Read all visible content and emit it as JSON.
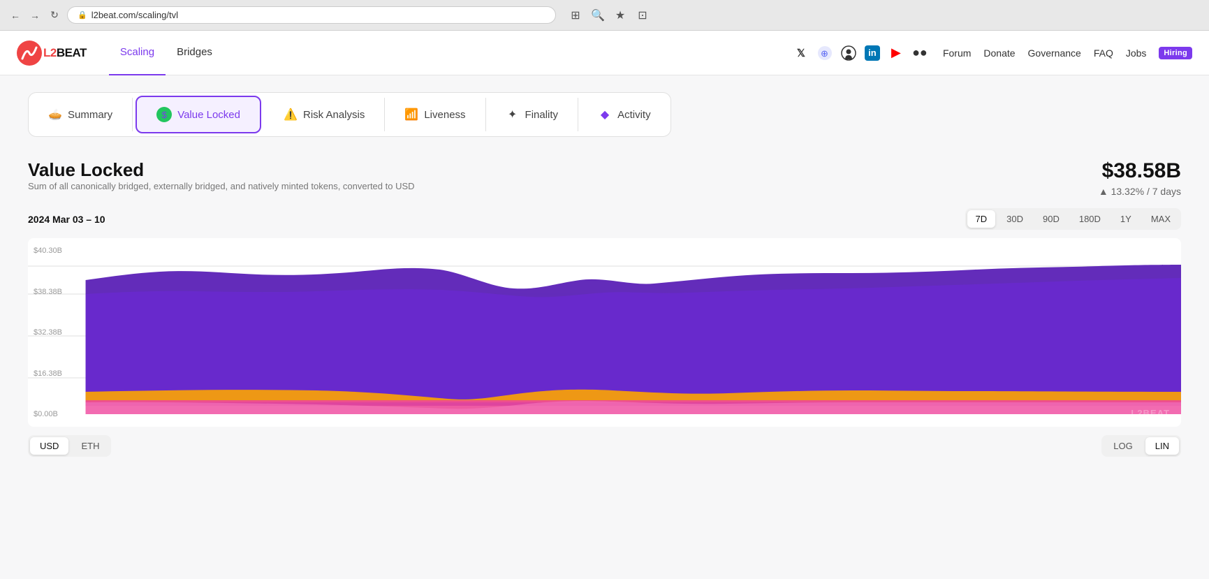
{
  "browser": {
    "url": "l2beat.com/scaling/tvl",
    "back_icon": "←",
    "forward_icon": "→",
    "refresh_icon": "↻"
  },
  "nav": {
    "logo_text": "BEAT",
    "links": [
      {
        "label": "Scaling",
        "active": true
      },
      {
        "label": "Bridges",
        "active": false
      }
    ],
    "social": [
      {
        "name": "twitter-x-icon",
        "symbol": "𝕏"
      },
      {
        "name": "discord-icon",
        "symbol": "⊕"
      },
      {
        "name": "github-icon",
        "symbol": "⊙"
      },
      {
        "name": "linkedin-icon",
        "symbol": "in"
      },
      {
        "name": "youtube-icon",
        "symbol": "▶"
      },
      {
        "name": "medium-icon",
        "symbol": "●"
      }
    ],
    "text_links": [
      {
        "label": "Forum"
      },
      {
        "label": "Donate"
      },
      {
        "label": "Governance"
      },
      {
        "label": "FAQ"
      },
      {
        "label": "Jobs"
      }
    ],
    "hiring_label": "Hiring"
  },
  "tabs": [
    {
      "label": "Summary",
      "icon": "🥧",
      "active": false
    },
    {
      "label": "Value Locked",
      "icon": "💲",
      "active": true
    },
    {
      "label": "Risk Analysis",
      "icon": "⚠️",
      "active": false
    },
    {
      "label": "Liveness",
      "icon": "📊",
      "active": false
    },
    {
      "label": "Finality",
      "icon": "✦",
      "active": false
    },
    {
      "label": "Activity",
      "icon": "🔷",
      "active": false
    }
  ],
  "value_locked": {
    "title": "Value Locked",
    "subtitle": "Sum of all canonically bridged, externally bridged, and natively minted tokens, converted to USD",
    "amount": "$38.58B",
    "change_pct": "▲ 13.32%",
    "change_period": " / 7 days",
    "date_range": "2024 Mar 03 – 10",
    "time_buttons": [
      {
        "label": "7D",
        "active": true
      },
      {
        "label": "30D",
        "active": false
      },
      {
        "label": "90D",
        "active": false
      },
      {
        "label": "180D",
        "active": false
      },
      {
        "label": "1Y",
        "active": false
      },
      {
        "label": "MAX",
        "active": false
      }
    ],
    "y_labels": [
      "$40.30B",
      "$38.38B",
      "$32.38B",
      "$16.38B",
      "$0.00B"
    ],
    "chart_watermark": "L2BEAT",
    "currency_buttons": [
      {
        "label": "USD",
        "active": true
      },
      {
        "label": "ETH",
        "active": false
      }
    ],
    "scale_buttons": [
      {
        "label": "LOG",
        "active": false
      },
      {
        "label": "LIN",
        "active": true
      }
    ]
  }
}
